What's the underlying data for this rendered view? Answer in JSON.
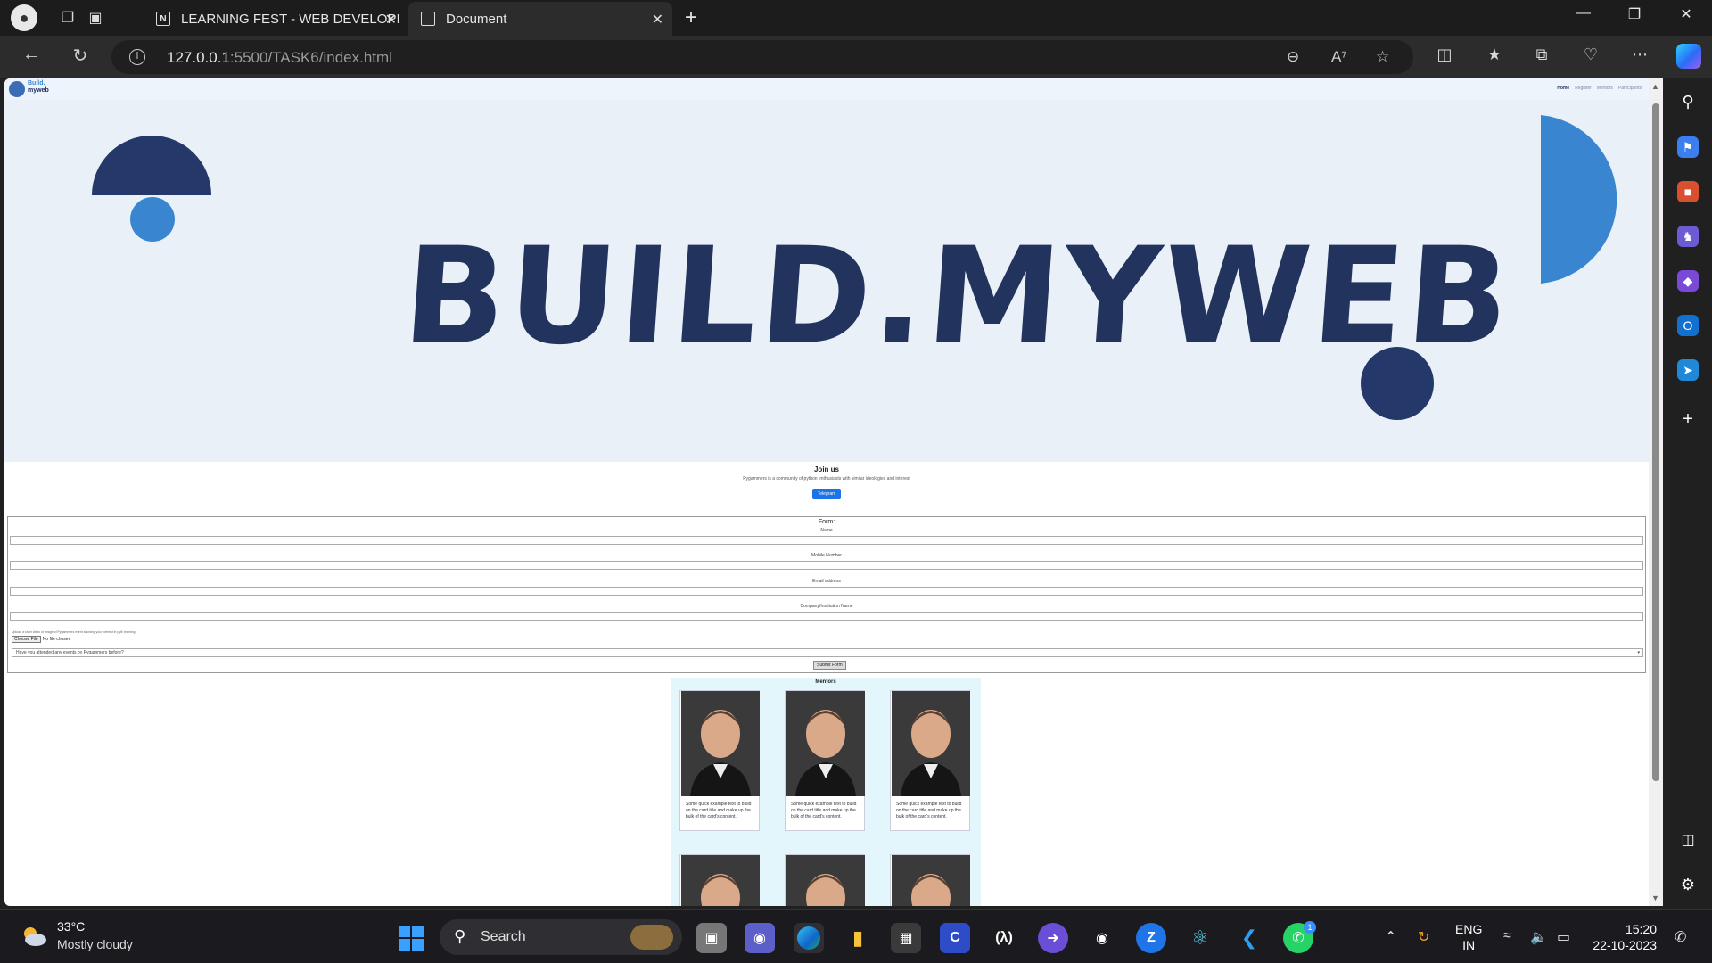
{
  "browser": {
    "tabs": [
      {
        "title": "LEARNING FEST - WEB DEVELOPI",
        "favicon": "notion-icon",
        "active": false
      },
      {
        "title": "Document",
        "favicon": "document-icon",
        "active": true
      }
    ],
    "url_host": "127.0.0.1",
    "url_path": ":5500/TASK6/index.html"
  },
  "site": {
    "logo_line1": "Build.",
    "logo_line2": "myweb",
    "nav_links": [
      "Home",
      "Register",
      "Mentors",
      "Participants"
    ],
    "hero_title": "BUILD.MYWEB",
    "join": {
      "heading": "Join us",
      "text": "Pygammers is a community of python enthusiasts with similar ideologies and interest",
      "button": "Telegram"
    },
    "form": {
      "legend": "Form:",
      "fields": [
        "Name",
        "Mobile Number",
        "Email address",
        "Company/Institution Name"
      ],
      "upload_hint": "Upload a short video or image of Pygammers event showing your interest in pyth learning",
      "file_button": "Choose File",
      "file_status": "No file chosen",
      "select_value": "Have you attended any events by Pygammers before?",
      "submit": "Submit Form"
    },
    "mentors": {
      "heading": "Mentors",
      "card_text": "Some quick example text to build on the card title and make up the bulk of the card's content."
    }
  },
  "taskbar": {
    "weather_temp": "33°C",
    "weather_desc": "Mostly cloudy",
    "search_label": "Search",
    "lang_line1": "ENG",
    "lang_line2": "IN",
    "time": "15:20",
    "date": "22-10-2023",
    "whatsapp_badge": "1"
  },
  "colors": {
    "hero_bg": "#eaf0f8",
    "navy": "#22345e",
    "blue": "#3a85d0",
    "telegram": "#1a73e8",
    "mentors_bg": "#e2f6fb"
  }
}
